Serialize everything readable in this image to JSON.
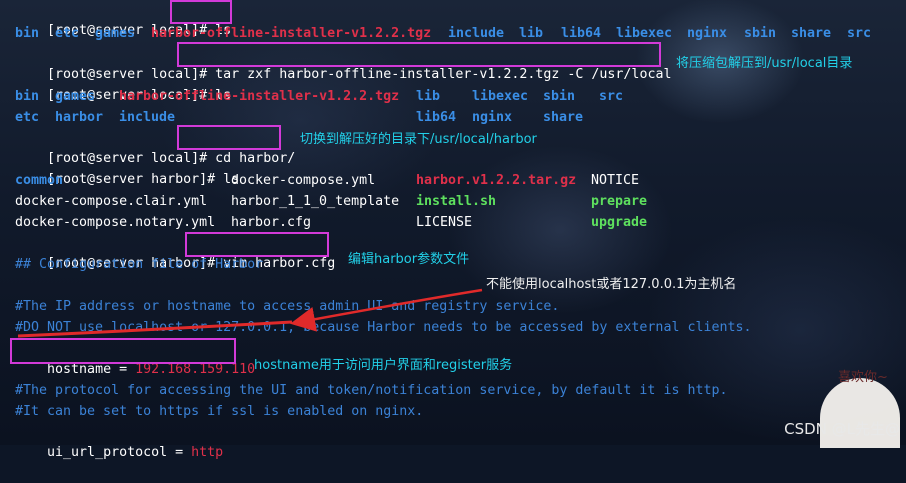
{
  "terminal": {
    "l1": {
      "prompt": "[root@server local]# ",
      "cmd": "ls"
    },
    "l2": [
      "bin",
      "etc",
      "games",
      "harbor-offline-installer-v1.2.2.tgz",
      "include",
      "lib",
      "lib64",
      "libexec",
      "nginx",
      "sbin",
      "share",
      "src"
    ],
    "l3": {
      "prompt": "[root@server local]# ",
      "cmd": "tar zxf harbor-offline-installer-v1.2.2.tgz -C /usr/local"
    },
    "l4": {
      "prompt": "[root@server local]# ",
      "cmd": "ls"
    },
    "l5": [
      "bin",
      "games",
      "harbor-offline-installer-v1.2.2.tgz",
      "lib",
      "libexec",
      "sbin",
      "src"
    ],
    "l6": [
      "etc",
      "harbor",
      "include",
      "lib64",
      "nginx",
      "share"
    ],
    "l7": {
      "prompt": "[root@server local]# ",
      "cmd": "cd harbor/"
    },
    "l8": {
      "prompt": "[root@server harbor]# ",
      "cmd": "ls"
    },
    "l9": [
      "common",
      "docker-compose.yml",
      "harbor.v1.2.2.tar.gz",
      "NOTICE"
    ],
    "l10": [
      "docker-compose.clair.yml",
      "harbor_1_1_0_template",
      "install.sh",
      "prepare"
    ],
    "l11": [
      "docker-compose.notary.yml",
      "harbor.cfg",
      "LICENSE",
      "upgrade"
    ],
    "l12": {
      "prompt": "[root@server harbor]# ",
      "cmd": "vim harbor.cfg"
    },
    "l13": "## Configuration file of Harbor",
    "l14": "#The IP address or hostname to access admin UI and registry service.",
    "l15": "#DO NOT use localhost or 127.0.0.1, because Harbor needs to be accessed by external clients.",
    "l16": {
      "key": "hostname = ",
      "value": "192.168.159.110"
    },
    "l17": "#The protocol for accessing the UI and token/notification service, by default it is http.",
    "l18": "#It can be set to https if ssl is enabled on nginx.",
    "l19": {
      "key": "ui_url_protocol = ",
      "value": "http"
    }
  },
  "annotations": {
    "extract": "将压缩包解压到/usr/local目录",
    "cd": "切换到解压好的目录下/usr/local/harbor",
    "edit": "编辑harbor参数文件",
    "no_localhost": "不能使用localhost或者127.0.0.1为主机名",
    "hostname": "hostname用于访问用户界面和register服务"
  },
  "watermark": "CSDN @L先生@",
  "sticker_text": "喜欢你~",
  "colors": {
    "highlight": "#d23ad8",
    "annotation": "#22d0e8",
    "dir": "#3a8ee6",
    "archive": "#e0304a",
    "exec": "#5ee05e",
    "comment": "#3b82d6",
    "arrow": "#e02a2a"
  }
}
